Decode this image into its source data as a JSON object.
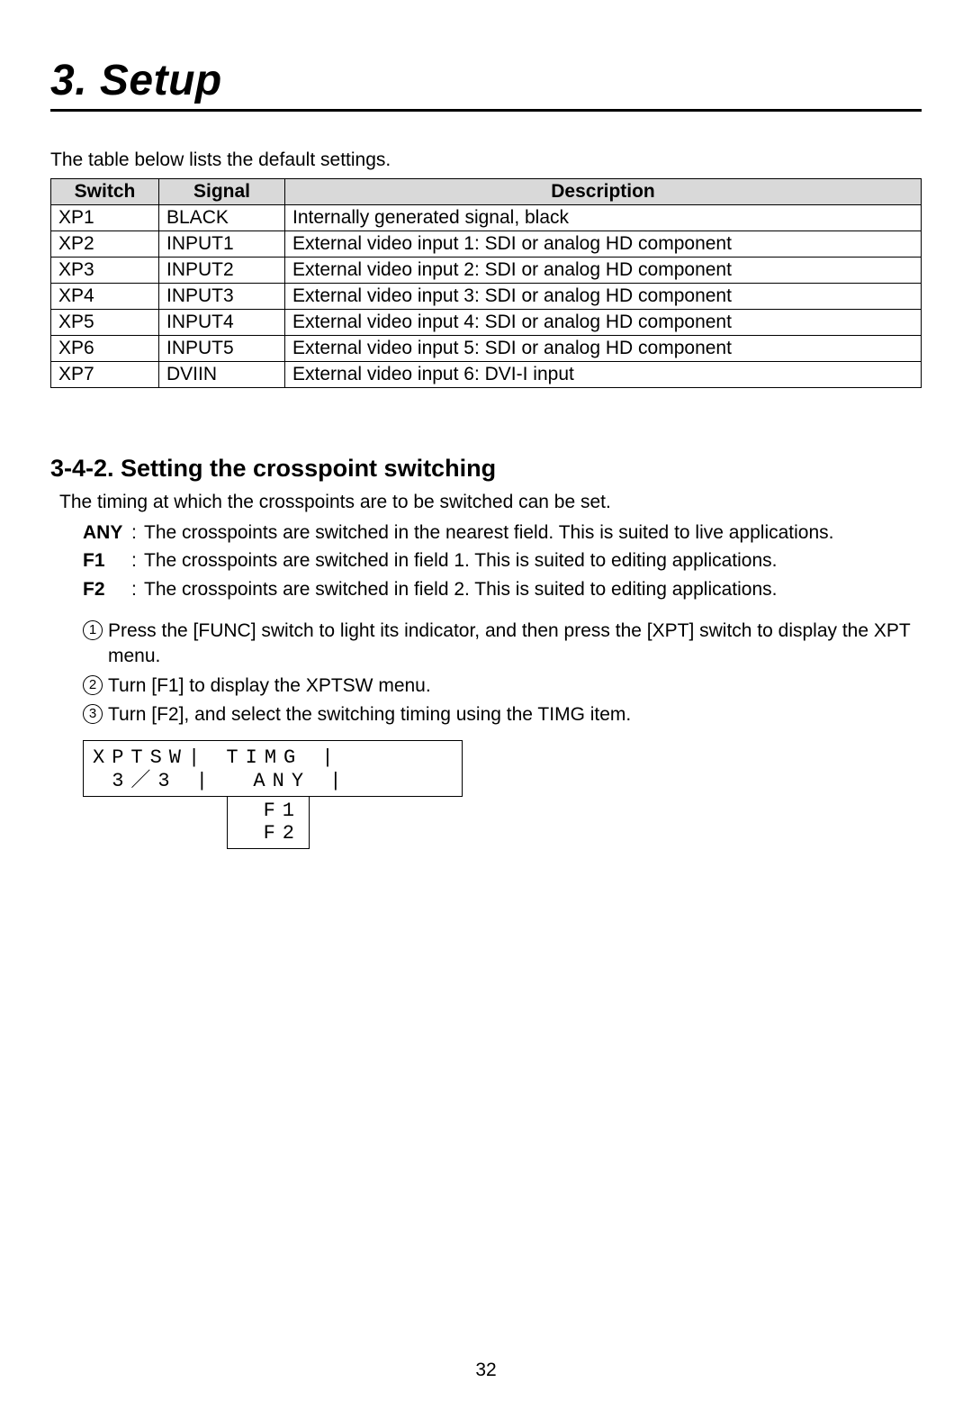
{
  "chapter_title": "3. Setup",
  "table_intro": "The table below lists the default settings.",
  "table": {
    "headers": [
      "Switch",
      "Signal",
      "Description"
    ],
    "rows": [
      {
        "switch": "XP1",
        "signal": "BLACK",
        "desc": "Internally generated signal, black"
      },
      {
        "switch": "XP2",
        "signal": "INPUT1",
        "desc": "External video input 1: SDI or analog HD component"
      },
      {
        "switch": "XP3",
        "signal": "INPUT2",
        "desc": "External video input 2: SDI or analog HD component"
      },
      {
        "switch": "XP4",
        "signal": "INPUT3",
        "desc": "External video input 3: SDI or analog HD component"
      },
      {
        "switch": "XP5",
        "signal": "INPUT4",
        "desc": "External video input 4: SDI or analog HD component"
      },
      {
        "switch": "XP6",
        "signal": "INPUT5",
        "desc": "External video input 5: SDI or analog HD component"
      },
      {
        "switch": "XP7",
        "signal": "DVIIN",
        "desc": "External video input 6: DVI-I input"
      }
    ]
  },
  "section_heading": "3-4-2. Setting the crosspoint switching",
  "section_lead": "The timing at which the crosspoints are to be switched can be set.",
  "definitions": [
    {
      "label": "ANY",
      "text": "The crosspoints are switched in the nearest field. This is suited to live applications."
    },
    {
      "label": "F1",
      "text": "The crosspoints are switched in field 1. This is suited to editing applications."
    },
    {
      "label": "F2",
      "text": "The crosspoints are switched in field 2. This is suited to editing applications."
    }
  ],
  "steps": [
    {
      "num": "1",
      "text": "Press the [FUNC] switch to light its indicator, and then press the [XPT] switch to display the XPT menu."
    },
    {
      "num": "2",
      "text": "Turn [F1] to display the XPTSW menu."
    },
    {
      "num": "3",
      "text": "Turn [F2], and select the switching timing using the TIMG item."
    }
  ],
  "lcd": {
    "row1": "XPTSW| TIMG |",
    "row2": " 3／3 |  ANY |",
    "sub1": "F1",
    "sub2": "F2"
  },
  "page_number": "32"
}
